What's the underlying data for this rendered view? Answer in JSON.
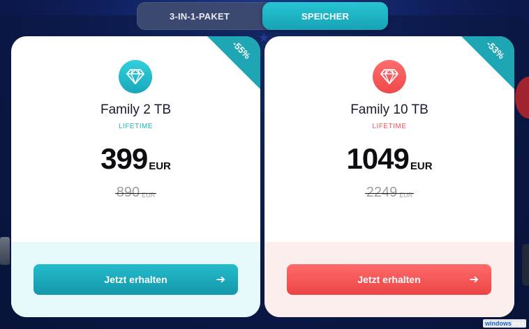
{
  "toggle": {
    "options": [
      {
        "label": "3-IN-1-PAKET",
        "active": false
      },
      {
        "label": "SPEICHER",
        "active": true
      }
    ],
    "active_color": "#1fb7c7"
  },
  "plans": [
    {
      "name": "Family 2 TB",
      "subtitle": "LIFETIME",
      "price": "399",
      "currency": "EUR",
      "old_price": "890",
      "old_currency": "EUR",
      "discount": "-55%",
      "cta": "Jetzt erhalten",
      "accent": "#1fb0c0",
      "icon": "diamond-icon"
    },
    {
      "name": "Family 10 TB",
      "subtitle": "LIFETIME",
      "price": "1049",
      "currency": "EUR",
      "old_price": "2249",
      "old_currency": "EUR",
      "discount": "-53%",
      "cta": "Jetzt erhalten",
      "accent": "#f05252",
      "icon": "diamond-icon"
    }
  ],
  "watermark": {
    "brand": "windows",
    "suffix": "area"
  }
}
